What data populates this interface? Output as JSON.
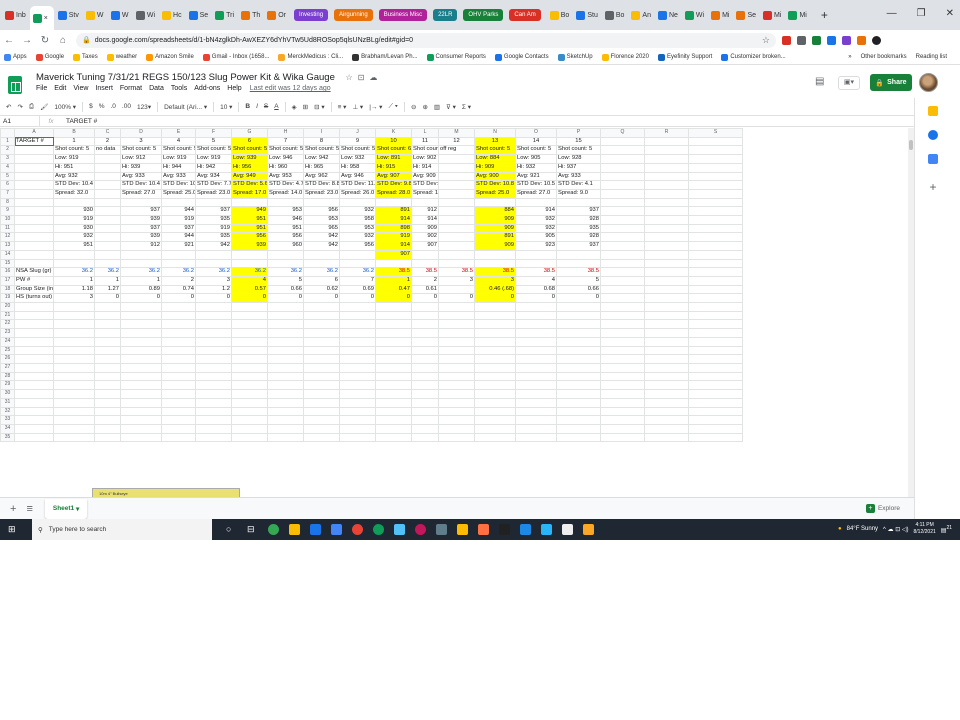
{
  "browser": {
    "tabs": [
      "Inb",
      "",
      "Stv",
      "W",
      "W",
      "Wi",
      "Hc",
      "Se",
      "Tri",
      "Th",
      "Or"
    ],
    "pinned_pills": [
      {
        "label": "Investing",
        "color": "#7b3fcf"
      },
      {
        "label": "Airgunning",
        "color": "#e8710a"
      },
      {
        "label": "Business Misc",
        "color": "#b0219a"
      },
      {
        "label": "22LR",
        "color": "#1a7f8a"
      },
      {
        "label": "OHV Parks",
        "color": "#188038"
      },
      {
        "label": "Can Am",
        "color": "#d93025"
      }
    ],
    "more_tabs": [
      "Bo",
      "Stu",
      "Bo",
      "An",
      "Ne",
      "Wi",
      "Mi",
      "Se",
      "Mi",
      "Mi"
    ],
    "url": "docs.google.com/spreadsheets/d/1-bN4zglkDh-AwXEZY6dYhVTw5Ud8ROSop5qlsUNzBLg/edit#gid=0",
    "bookmarks": [
      "Apps",
      "Google",
      "Taxes",
      "weather",
      "Amazon Smile",
      "Gmail - Inbox (1658...",
      "MerckMedicus : Cli...",
      "Brabham/Levan Ph...",
      "Consumer Reports",
      "Google Contacts",
      "SketchUp",
      "Florence 2020",
      "Eyefinity Support",
      "Customizer broken..."
    ],
    "bookmarks_right": [
      "»",
      "Other bookmarks",
      "Reading list"
    ]
  },
  "doc": {
    "title": "Maverick Tuning 7/31/21 REGS 150/123 Slug Power Kit & Wika Gauge",
    "menus": [
      "File",
      "Edit",
      "View",
      "Insert",
      "Format",
      "Data",
      "Tools",
      "Add-ons",
      "Help"
    ],
    "last_edit": "Last edit was 12 days ago",
    "share": "Share"
  },
  "toolbar": {
    "zoom": "100%",
    "dollar": "$",
    "percent": "%",
    "dec0": ".0",
    "dec00": ".00",
    "fmt123": "123",
    "font": "Default (Ari...",
    "size": "10",
    "bold": "B",
    "italic": "I",
    "strike": "S",
    "underline": "A"
  },
  "formula": {
    "cell": "A1",
    "fx": "fx",
    "value": "TARGET #"
  },
  "columns": [
    "",
    "A",
    "B",
    "C",
    "D",
    "E",
    "F",
    "G",
    "H",
    "I",
    "J",
    "K",
    "L",
    "M",
    "N",
    "O",
    "P",
    "Q",
    "R",
    "S"
  ],
  "rows": [
    [
      "TARGET #",
      "1",
      "2",
      "3",
      "4",
      "5",
      "6",
      "7",
      "8",
      "9",
      "10",
      "11",
      "12",
      "13",
      "14",
      "15",
      "",
      "",
      ""
    ],
    [
      "",
      "Shot count: 5",
      "no data",
      "Shot count: 5",
      "Shot count: 5",
      "Shot count: 5",
      "Shot count: 5",
      "Shot count: 5",
      "Shot count: 5",
      "Shot count: 5",
      "Shot count: 6",
      "Shot count: 5",
      "off reg",
      "Shot count: 5",
      "Shot count: 5",
      "Shot count: 5",
      "",
      "",
      ""
    ],
    [
      "",
      "Low: 919",
      "",
      "Low: 912",
      "Low: 919",
      "Low: 919",
      "Low: 939",
      "Low: 946",
      "Low: 942",
      "Low: 932",
      "Low: 891",
      "Low: 902",
      "",
      "Low: 884",
      "Low: 905",
      "Low: 928",
      "",
      "",
      ""
    ],
    [
      "",
      "Hi: 951",
      "",
      "Hi: 939",
      "Hi: 944",
      "Hi: 942",
      "Hi: 956",
      "Hi: 960",
      "Hi: 965",
      "Hi: 958",
      "Hi: 915",
      "Hi: 914",
      "",
      "Hi: 909",
      "Hi: 932",
      "Hi: 937",
      "",
      "",
      ""
    ],
    [
      "",
      "Avg: 932",
      "",
      "Avg: 933",
      "Avg: 933",
      "Avg: 934",
      "Avg: 949",
      "Avg: 953",
      "Avg: 962",
      "Avg: 946",
      "Avg: 907",
      "Avg: 909",
      "",
      "Avg: 900",
      "Avg: 921",
      "Avg: 933",
      "",
      "",
      ""
    ],
    [
      "",
      "STD Dev: 10.4",
      "",
      "STD Dev: 10.4",
      "STD Dev: 10.9",
      "STD Dev: 7.7",
      "STD Dev: 5.6",
      "STD Dev: 4.7",
      "STD Dev: 8.8",
      "STD Dev: 11.7",
      "STD Dev: 9.8",
      "STD Dev: 4.2",
      "",
      "STD Dev: 10.8",
      "STD Dev: 10.5",
      "STD Dev: 4.1",
      "",
      "",
      ""
    ],
    [
      "",
      "Spread: 32.0",
      "",
      "Spread: 27.0",
      "Spread: 25.0",
      "Spread: 23.0",
      "Spread: 17.0",
      "Spread: 14.0",
      "Spread: 23.0",
      "Spread: 26.0",
      "Spread: 28.0",
      "Spread: 12.0",
      "",
      "Spread: 25.0",
      "Spread: 27.0",
      "Spread: 9.0",
      "",
      "",
      ""
    ],
    [
      "",
      "",
      "",
      "",
      "",
      "",
      "",
      "",
      "",
      "",
      "",
      "",
      "",
      "",
      "",
      "",
      "",
      "",
      ""
    ],
    [
      "",
      "930",
      "",
      "937",
      "944",
      "937",
      "949",
      "953",
      "956",
      "932",
      "891",
      "912",
      "",
      "884",
      "914",
      "937",
      "",
      "",
      ""
    ],
    [
      "",
      "919",
      "",
      "939",
      "919",
      "935",
      "951",
      "946",
      "953",
      "958",
      "914",
      "914",
      "",
      "909",
      "932",
      "928",
      "",
      "",
      ""
    ],
    [
      "",
      "930",
      "",
      "937",
      "937",
      "919",
      "951",
      "951",
      "965",
      "953",
      "898",
      "909",
      "",
      "909",
      "932",
      "935",
      "",
      "",
      ""
    ],
    [
      "",
      "932",
      "",
      "939",
      "944",
      "935",
      "956",
      "956",
      "942",
      "932",
      "919",
      "902",
      "",
      "891",
      "905",
      "928",
      "",
      "",
      ""
    ],
    [
      "",
      "951",
      "",
      "912",
      "921",
      "942",
      "939",
      "960",
      "942",
      "956",
      "914",
      "907",
      "",
      "909",
      "923",
      "937",
      "",
      "",
      ""
    ],
    [
      "",
      "",
      "",
      "",
      "",
      "",
      "",
      "",
      "",
      "",
      "907",
      "",
      "",
      "",
      "",
      "",
      "",
      "",
      ""
    ],
    [
      "",
      "",
      "",
      "",
      "",
      "",
      "",
      "",
      "",
      "",
      "",
      "",
      "",
      "",
      "",
      "",
      "",
      "",
      ""
    ],
    [
      "NSA Slug (gr)",
      "36.2",
      "36.2",
      "36.2",
      "36.2",
      "36.2",
      "36.2",
      "36.2",
      "36.2",
      "36.2",
      "38.5",
      "38.5",
      "38.5",
      "38.5",
      "38.5",
      "38.5",
      "",
      "",
      ""
    ],
    [
      "PW #",
      "1",
      "1",
      "1",
      "2",
      "3",
      "4",
      "5",
      "6",
      "7",
      "1",
      "2",
      "3",
      "3",
      "4",
      "5",
      "",
      "",
      ""
    ],
    [
      "Group Size (in)",
      "1.18",
      "1.27",
      "0.89",
      "0.74",
      "1.2",
      "0.57",
      "0.66",
      "0.62",
      "0.69",
      "0.47",
      "0.61",
      "",
      "0.46 (.68)",
      "0.68",
      "0.66",
      "",
      "",
      ""
    ],
    [
      "HS (turns out)",
      "3",
      "0",
      "0",
      "0",
      "0",
      "0",
      "0",
      "0",
      "0",
      "0",
      "0",
      "0",
      "0",
      "0",
      "0",
      "",
      "",
      ""
    ]
  ],
  "row_count": 35,
  "target_card_header": "10m 4\" Bullseye",
  "sheet": {
    "name": "Sheet1",
    "explore": "Explore"
  },
  "taskbar": {
    "search_placeholder": "Type here to search",
    "weather": "84°F Sunny",
    "time": "4:11 PM",
    "date": "8/12/2021",
    "notifications": "21"
  }
}
